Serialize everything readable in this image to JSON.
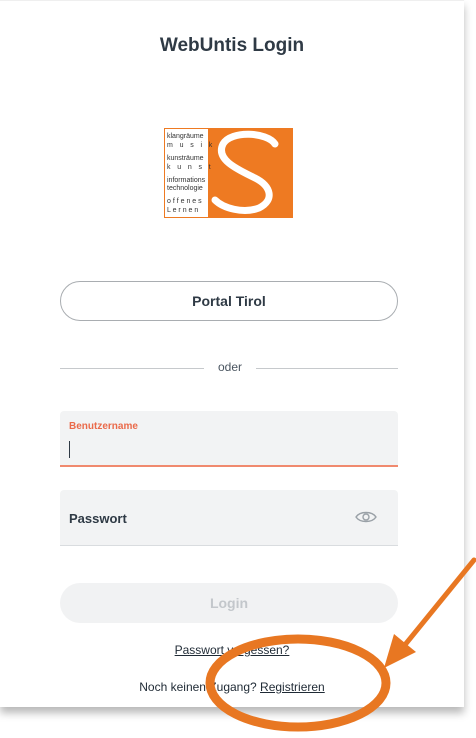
{
  "page": {
    "title": "WebUntis Login"
  },
  "logo": {
    "lines": [
      "klangräume",
      "m u s i k",
      "kunsträume",
      "k u n s t",
      "informations",
      "technologie",
      "o f f e n e s",
      "L e r n e n"
    ],
    "brand_color": "#ee7a22"
  },
  "sso": {
    "button_label": "Portal Tirol"
  },
  "divider": {
    "label": "oder"
  },
  "form": {
    "username_label": "Benutzername",
    "username_value": "",
    "password_label": "Passwort",
    "password_value": "",
    "eye_icon": "eye-icon",
    "login_label": "Login"
  },
  "links": {
    "forgot_password": "Passwort vergessen?",
    "no_access_text": "Noch keinen Zugang?",
    "register": "Registrieren"
  },
  "colors": {
    "accent": "#ea6a4a",
    "annotation": "#e87722",
    "text": "#2f3a45"
  }
}
